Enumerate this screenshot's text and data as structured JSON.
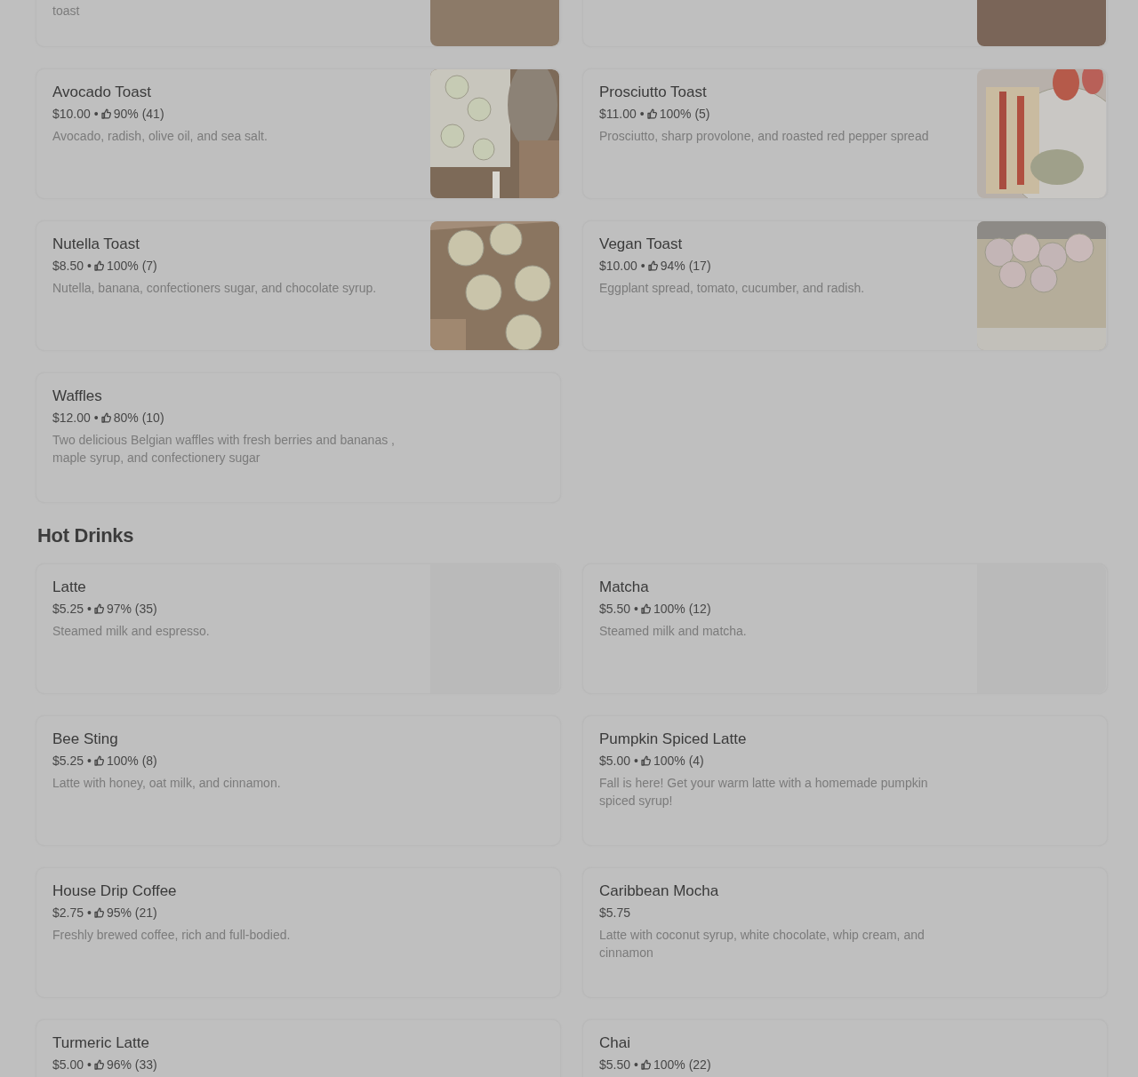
{
  "sections": [
    {
      "items": [
        {
          "kind": "cut",
          "description": "toast"
        },
        {
          "kind": "cut"
        },
        {
          "kind": "full",
          "name": "Avocado Toast",
          "price": "$10.00",
          "separator": "•",
          "rating": "90% (41)",
          "description": "Avocado, radish, olive oil, and sea salt."
        },
        {
          "kind": "full",
          "name": "Prosciutto Toast",
          "price": "$11.00",
          "separator": "•",
          "rating": "100% (5)",
          "description": "Prosciutto, sharp provolone, and roasted red pepper spread"
        },
        {
          "kind": "full",
          "name": "Nutella Toast",
          "price": "$8.50",
          "separator": "•",
          "rating": "100% (7)",
          "description": "Nutella, banana, confectioners sugar, and chocolate syrup."
        },
        {
          "kind": "full",
          "name": "Vegan Toast",
          "price": "$10.00",
          "separator": "•",
          "rating": "94% (17)",
          "description": "Eggplant spread, tomato, cucumber, and radish."
        },
        {
          "kind": "full",
          "name": "Waffles",
          "price": "$12.00",
          "separator": "•",
          "rating": "80% (10)",
          "description": "Two delicious Belgian waffles with fresh berries and bananas , maple syrup, and confectionery sugar"
        }
      ]
    },
    {
      "title": "Hot Drinks",
      "items": [
        {
          "kind": "full",
          "name": "Latte",
          "price": "$5.25",
          "separator": "•",
          "rating": "97% (35)",
          "description": "Steamed milk and espresso.",
          "media": {
            "kind": "placeholder"
          }
        },
        {
          "kind": "full",
          "name": "Matcha",
          "price": "$5.50",
          "separator": "•",
          "rating": "100% (12)",
          "description": "Steamed milk and matcha.",
          "media": {
            "kind": "placeholder"
          }
        },
        {
          "kind": "full",
          "name": "Bee Sting",
          "price": "$5.25",
          "separator": "•",
          "rating": "100% (8)",
          "description": "Latte with honey, oat milk, and cinnamon."
        },
        {
          "kind": "full",
          "name": "Pumpkin Spiced Latte",
          "price": "$5.00",
          "separator": "•",
          "rating": "100% (4)",
          "description": "Fall is here! Get your warm latte with a homemade pumpkin spiced syrup!"
        },
        {
          "kind": "full",
          "name": "House Drip Coffee",
          "price": "$2.75",
          "separator": "•",
          "rating": "95% (21)",
          "description": "Freshly brewed coffee, rich and full-bodied."
        },
        {
          "kind": "full",
          "name": "Caribbean Mocha",
          "price": "$5.75",
          "description": "Latte with coconut syrup, white chocolate, whip cream, and cinnamon"
        },
        {
          "kind": "full",
          "name": "Turmeric Latte",
          "price": "$5.00",
          "separator": "•",
          "rating": "96% (33)"
        },
        {
          "kind": "full",
          "name": "Chai",
          "price": "$5.50",
          "separator": "•",
          "rating": "100% (22)"
        }
      ]
    }
  ]
}
